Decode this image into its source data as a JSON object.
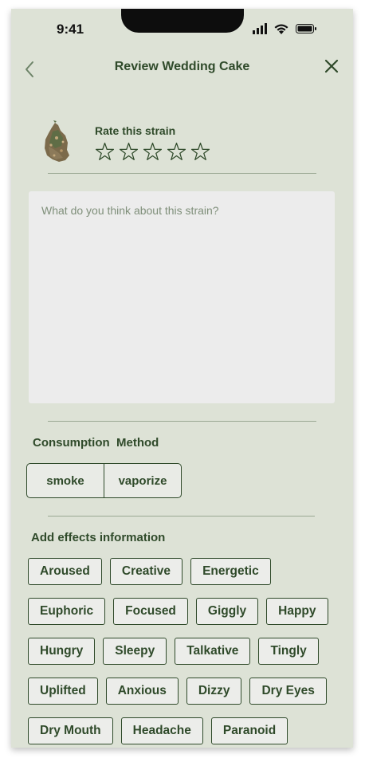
{
  "status_bar": {
    "time": "9:41"
  },
  "nav": {
    "title": "Review Wedding Cake"
  },
  "rating": {
    "label": "Rate this strain",
    "max_stars": 5,
    "value": 0
  },
  "review": {
    "placeholder": "What do you think about this strain?",
    "value": ""
  },
  "consumption": {
    "label": "Consumption  Method",
    "options": [
      "smoke",
      "vaporize"
    ]
  },
  "effects": {
    "label": "Add effects information",
    "rows": [
      [
        "Aroused",
        "Creative",
        "Energetic"
      ],
      [
        "Euphoric",
        "Focused",
        "Giggly",
        "Happy"
      ],
      [
        "Hungry",
        "Sleepy",
        "Talkative",
        "Tingly"
      ],
      [
        "Uplifted",
        "Anxious",
        "Dizzy",
        "Dry Eyes"
      ],
      [
        "Dry Mouth",
        "Headache",
        "Paranoid"
      ]
    ]
  },
  "colors": {
    "accent": "#2f4a2a",
    "background": "#dde2d6",
    "input_bg": "#ececec"
  }
}
